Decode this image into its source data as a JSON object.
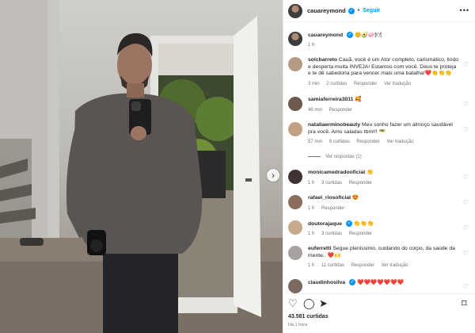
{
  "header": {
    "username": "cauareymond",
    "verified_mark": "✓",
    "follow_label": "Seguir",
    "more_label": "•••"
  },
  "caption": {
    "username": "cauareymond",
    "text": "😊🥑🧼🍽",
    "time": "1 h"
  },
  "comments": [
    {
      "username": "solcbarreto",
      "text": "Cauã, você é um Ator completo, carismático, lindo e desperta muita INVEJA! Estamos com você. Deus te proteja e te dê sabedoria para vencer mais uma batalha!❤️👏👏👏",
      "time": "3 min",
      "likes": "2 curtidas",
      "reply": "Responder",
      "translate": "Ver tradução"
    },
    {
      "username": "samiaferreira3011",
      "text": "🥰",
      "time": "46 min",
      "likes": "",
      "reply": "Responder",
      "translate": ""
    },
    {
      "username": "nataliaerminobeauty",
      "text": "Meu sonho fazer um almoço saudável pra você. Amo saladas tbm!!! 🥗",
      "time": "57 min",
      "likes": "9 curtidas",
      "reply": "Responder",
      "translate": "Ver tradução"
    },
    {
      "username": "monicamedradooficial",
      "text": "👏",
      "time": "1 h",
      "likes": "3 curtidas",
      "reply": "Responder",
      "translate": ""
    },
    {
      "username": "rafael_riosoficial",
      "text": "😍",
      "time": "1 h",
      "likes": "",
      "reply": "Responder",
      "translate": ""
    },
    {
      "username": "doutorajaque",
      "verified": true,
      "text": "👏👏👏",
      "time": "1 h",
      "likes": "3 curtidas",
      "reply": "Responder",
      "translate": ""
    },
    {
      "username": "euferretti",
      "text": "Segue plenissimo, cuidando do corpo, da saúde da mente.. ❤️🙌",
      "time": "1 h",
      "likes": "11 curtidas",
      "reply": "Responder",
      "translate": "Ver tradução"
    },
    {
      "username": "claudinhosilva",
      "verified": true,
      "text": "❤️❤️❤️❤️❤️❤️❤️",
      "time": "",
      "likes": "",
      "reply": "",
      "translate": ""
    }
  ],
  "view_replies": "Ver respostas (1)",
  "footer": {
    "likes": "43.581 curtidas",
    "time": "Há 1 hora"
  },
  "icons": {
    "like": "♡",
    "comment": "◯",
    "share": "➤",
    "save": "⌑",
    "heart": "♡",
    "next": "›"
  },
  "colors": {
    "accent": "#0095f6",
    "text": "#262626",
    "muted": "#737373"
  }
}
